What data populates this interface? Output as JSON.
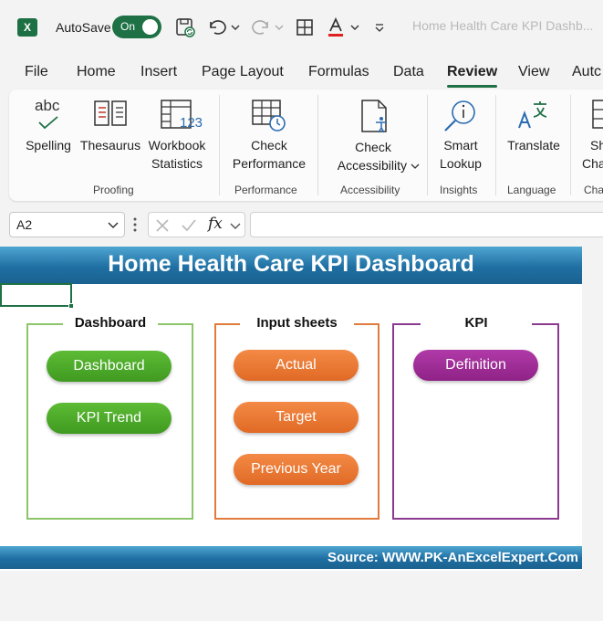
{
  "title_bar": {
    "autosave_label": "AutoSave",
    "autosave_state": "On",
    "document_title": "Home Health Care KPI Dashb...",
    "quick_access": [
      "save-icon",
      "undo-icon",
      "redo-icon",
      "borders-icon",
      "font-color-icon",
      "customize-icon"
    ]
  },
  "tabs": [
    {
      "label": "File"
    },
    {
      "label": "Home"
    },
    {
      "label": "Insert"
    },
    {
      "label": "Page Layout"
    },
    {
      "label": "Formulas"
    },
    {
      "label": "Data"
    },
    {
      "label": "Review",
      "active": true
    },
    {
      "label": "View"
    },
    {
      "label": "Autc"
    }
  ],
  "ribbon": {
    "spelling": {
      "line1": "Spelling",
      "icon_text": "abc"
    },
    "thesaurus": {
      "line1": "Thesaurus"
    },
    "workbook_statistics": {
      "line1": "Workbook",
      "line2": "Statistics",
      "icon_text": "123"
    },
    "check_performance": {
      "line1": "Check",
      "line2": "Performance"
    },
    "check_accessibility": {
      "line1": "Check",
      "line2": "Accessibility"
    },
    "smart_lookup": {
      "line1": "Smart",
      "line2": "Lookup"
    },
    "translate": {
      "line1": "Translate"
    },
    "cut_off": {
      "line1": "Sh",
      "line2": "Cha"
    },
    "groups": {
      "proofing": "Proofing",
      "performance": "Performance",
      "accessibility": "Accessibility",
      "insights": "Insights",
      "language": "Language",
      "cut_off": "Cha"
    }
  },
  "formula_bar": {
    "name_box": "A2",
    "fx": "fx",
    "formula": ""
  },
  "sheet": {
    "banner_title": "Home Health Care KPI Dashboard",
    "footer": "Source: WWW.PK-AnExcelExpert.Com",
    "sections": {
      "dashboard": {
        "title": "Dashboard",
        "color": "#8cc56a",
        "buttons": [
          "Dashboard",
          "KPI Trend"
        ]
      },
      "input_sheets": {
        "title": "Input sheets",
        "color": "#e07b3c",
        "buttons": [
          "Actual",
          "Target",
          "Previous Year"
        ]
      },
      "kpi": {
        "title": "KPI",
        "color": "#8c3a8f",
        "buttons": [
          "Definition"
        ]
      }
    }
  },
  "colors": {
    "excel_green": "#1e7145",
    "banner_blue": "#1f6fa3",
    "pill_green": "#4caf2a",
    "pill_orange": "#e8742f",
    "pill_purple": "#9e2c96"
  }
}
